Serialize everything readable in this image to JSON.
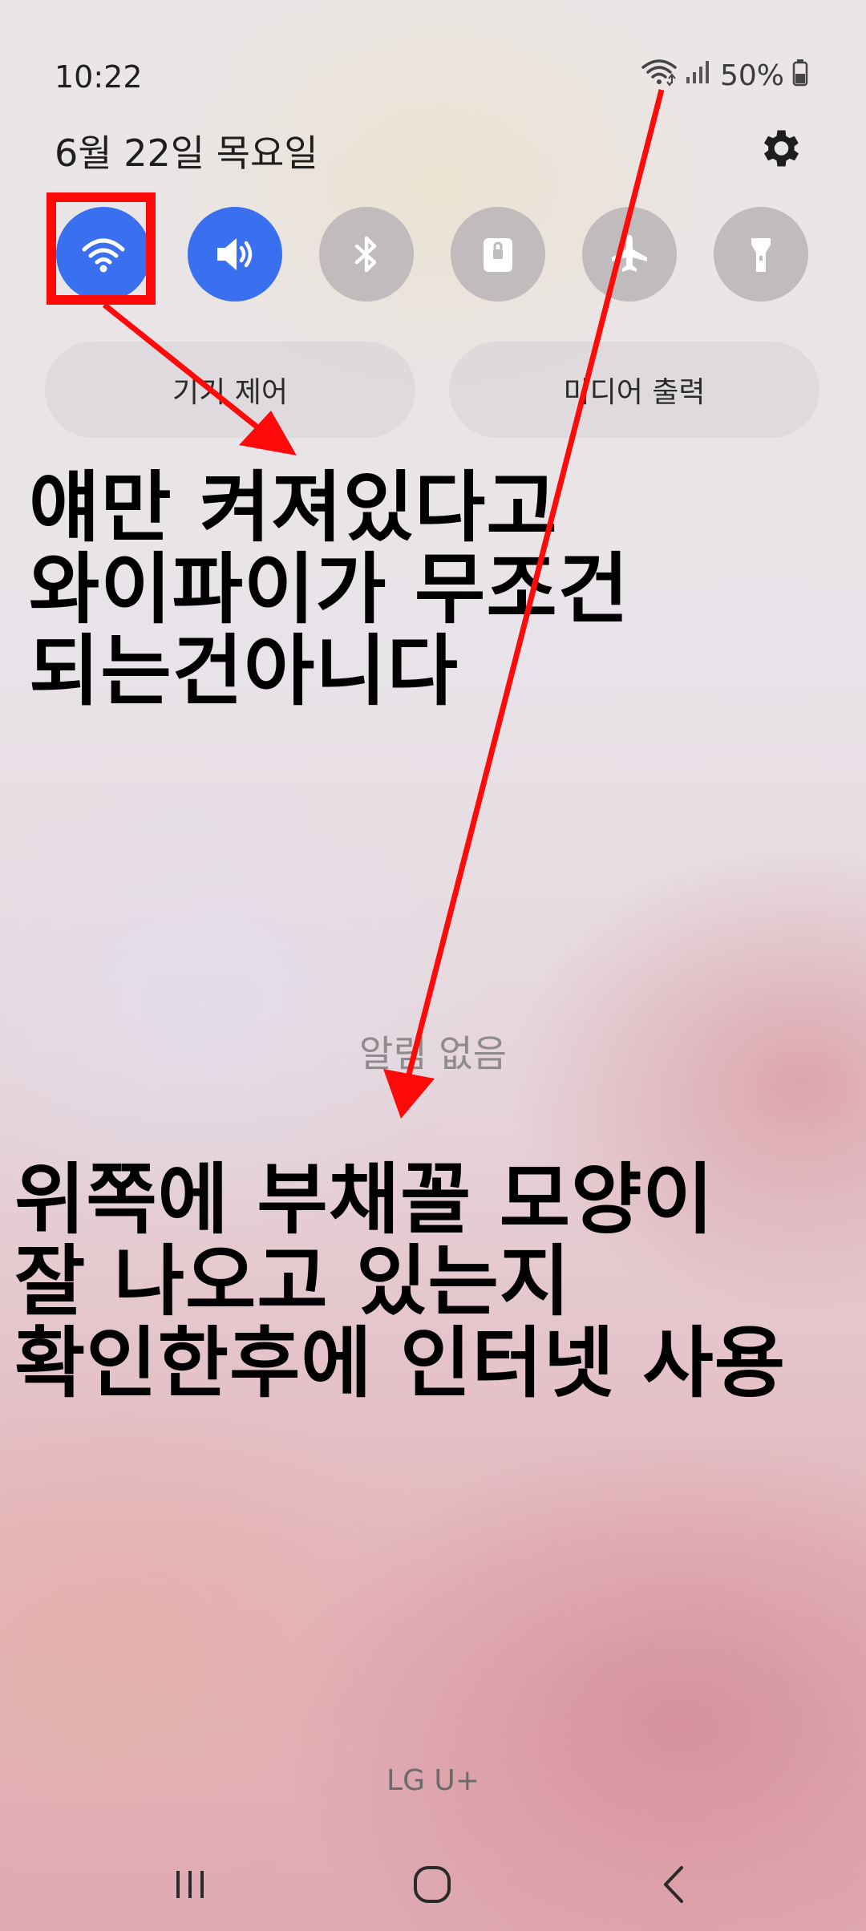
{
  "status_bar": {
    "time": "10:22",
    "battery_percent": "50%",
    "icons": [
      "wifi-icon",
      "signal-icon",
      "battery-icon"
    ]
  },
  "header": {
    "date": "6월 22일 목요일",
    "settings_icon": "gear-icon"
  },
  "quick_toggles": [
    {
      "name": "wifi",
      "icon": "wifi-icon",
      "state": "on"
    },
    {
      "name": "sound",
      "icon": "speaker-icon",
      "state": "on"
    },
    {
      "name": "bluetooth",
      "icon": "bluetooth-icon",
      "state": "off"
    },
    {
      "name": "lock",
      "icon": "lock-icon",
      "state": "off"
    },
    {
      "name": "airplane",
      "icon": "airplane-icon",
      "state": "off"
    },
    {
      "name": "flashlight",
      "icon": "flashlight-icon",
      "state": "off"
    }
  ],
  "buttons": {
    "device_control": "기기 제어",
    "media_output": "미디어 출력"
  },
  "annotations": {
    "top": "얘만 켜져있다고\n와이파이가 무조건\n되는건아니다",
    "bottom": "위쪽에 부채꼴 모양이\n잘 나오고 있는지\n확인한후에 인터넷 사용"
  },
  "notifications": {
    "empty_text": "알림 없음"
  },
  "carrier": "LG U+",
  "colors": {
    "toggle_on": "#3a6ff0",
    "toggle_off": "#c0bbbd",
    "annotation_red": "#ff0a0a"
  },
  "nav": {
    "recents_icon": "recents-icon",
    "home_icon": "home-icon",
    "back_icon": "back-icon"
  }
}
